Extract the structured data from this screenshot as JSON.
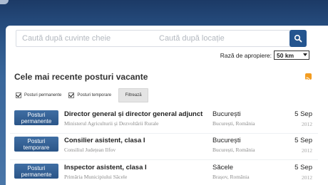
{
  "search": {
    "keywords_placeholder": "Caută după cuvinte cheie",
    "location_placeholder": "Caută după locație",
    "search_icon": "search-icon"
  },
  "radius": {
    "label": "Rază de apropiere:",
    "selected": "50 km"
  },
  "section": {
    "title": "Cele mai recente posturi vacante",
    "rss_icon": "rss-icon"
  },
  "filters": {
    "permanent_label": "Posturi permanente",
    "temporary_label": "Posturi temporare",
    "filter_button": "Filtrează",
    "permanent_checked": true,
    "temporary_checked": true
  },
  "jobs": [
    {
      "badge": "Posturi permanente",
      "title": "Director general și director general adjunct",
      "employer": "Ministerul Agriculturii și Dezvoltării Rurale",
      "city": "București",
      "region": "București, România",
      "date": "5 Sep",
      "year": "2012"
    },
    {
      "badge": "Posturi temporare",
      "title": "Consilier asistent, clasa I",
      "employer": "Consiliul Județean Ilfov",
      "city": "București",
      "region": "București, România",
      "date": "5 Sep",
      "year": "2012"
    },
    {
      "badge": "Posturi permanente",
      "title": "Inspector asistent, clasa I",
      "employer": "Primăria Municipiului Săcele",
      "city": "Săcele",
      "region": "Brașov, România",
      "date": "5 Sep",
      "year": "2012"
    }
  ],
  "colors": {
    "header_bg": "#24497a",
    "badge": "#2f5c91",
    "search_button": "#24558f",
    "rss": "#f39c20"
  }
}
